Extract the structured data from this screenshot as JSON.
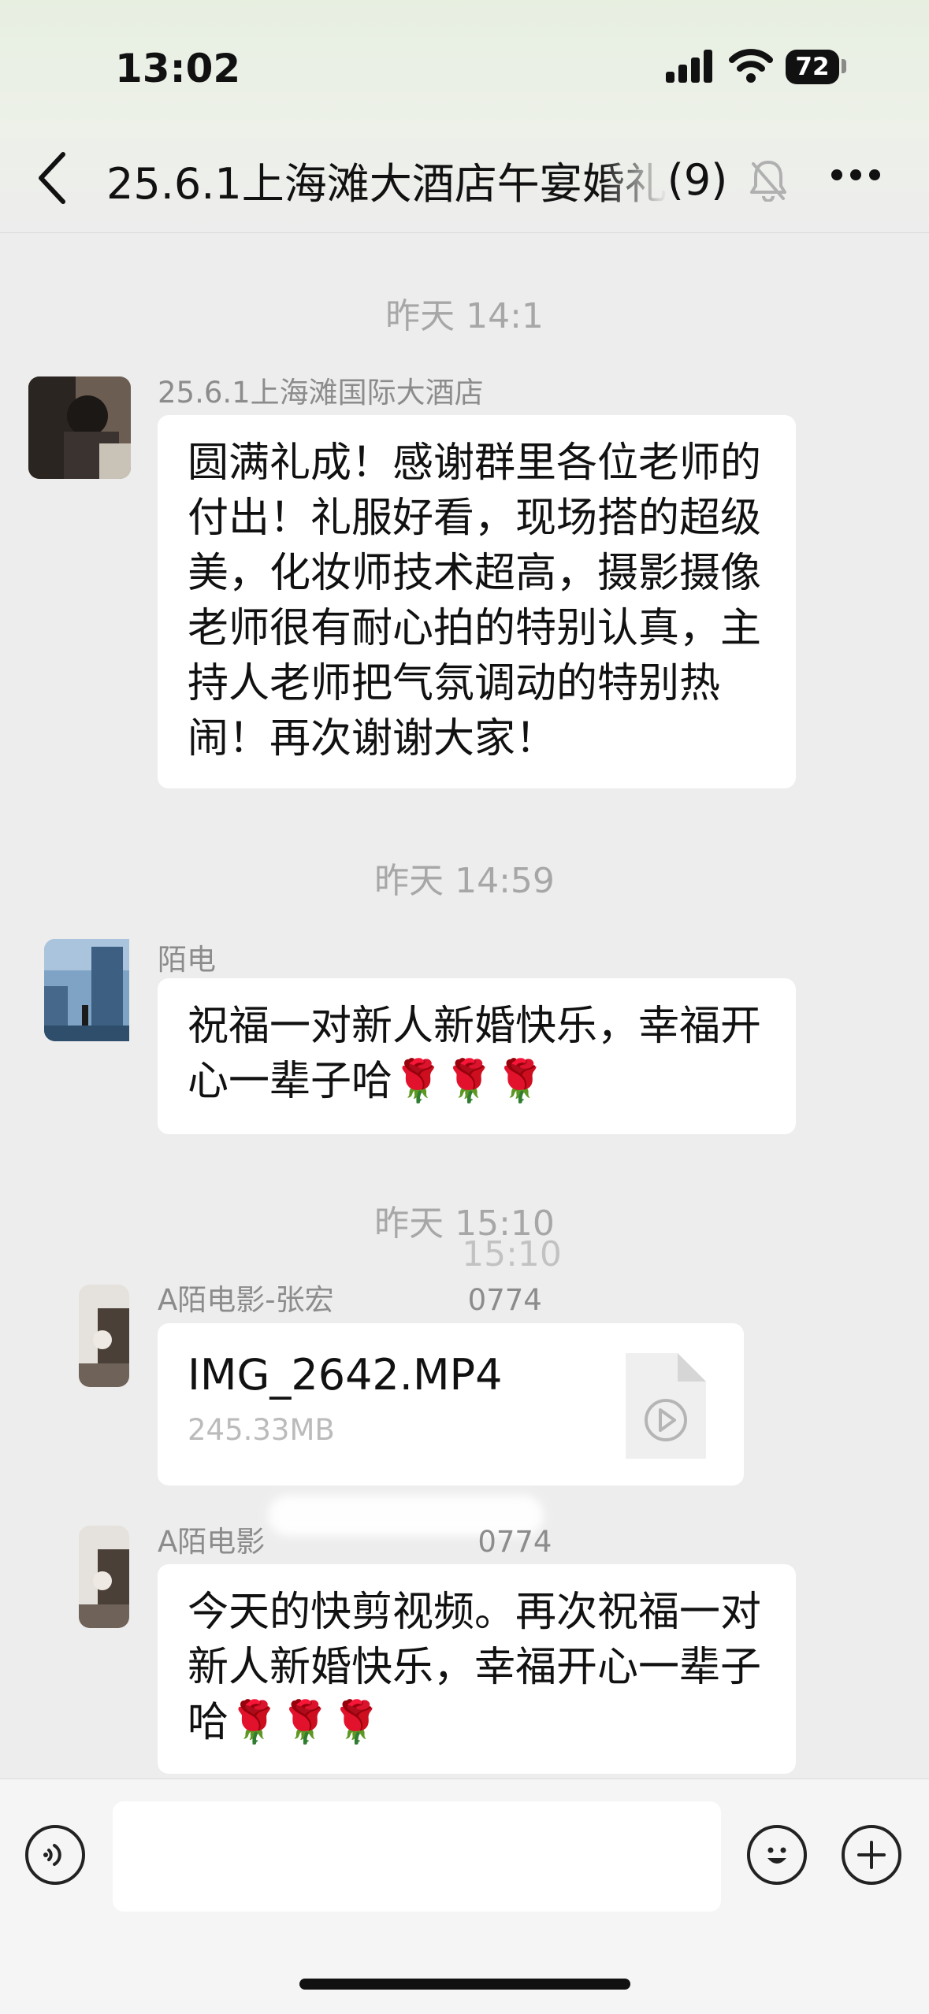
{
  "status_bar": {
    "time": "13:02",
    "battery": "72"
  },
  "header": {
    "group_name": "25.6.1上海滩大酒店午宴婚礼",
    "member_count": "(9)"
  },
  "messages": [
    {
      "timestamp": "昨天 14:1",
      "sender": "25.6.1上海滩国际大酒店",
      "text": "圆满礼成！感谢群里各位老师的付出！礼服好看，现场搭的超级美，化妆师技术超高，摄影摄像老师很有耐心拍的特别认真，主持人老师把气氛调动的特别热闹！再次谢谢大家！"
    },
    {
      "timestamp": "昨天 14:59",
      "sender": "陌电",
      "text": "祝福一对新人新婚快乐，幸福开心一辈子哈🌹🌹🌹"
    },
    {
      "timestamp": "昨天 15:10",
      "timestamp_ghost": "15:10",
      "sender": "A陌电影-张宏",
      "sender_tail": "0774",
      "file": {
        "name": "IMG_2642.MP4",
        "size": "245.33MB"
      }
    },
    {
      "sender": "A陌电影",
      "sender_tail": "0774",
      "text": "今天的快剪视频。再次祝福一对新人新婚快乐，幸福开心一辈子哈🌹🌹🌹"
    }
  ],
  "input": {
    "placeholder": ""
  }
}
